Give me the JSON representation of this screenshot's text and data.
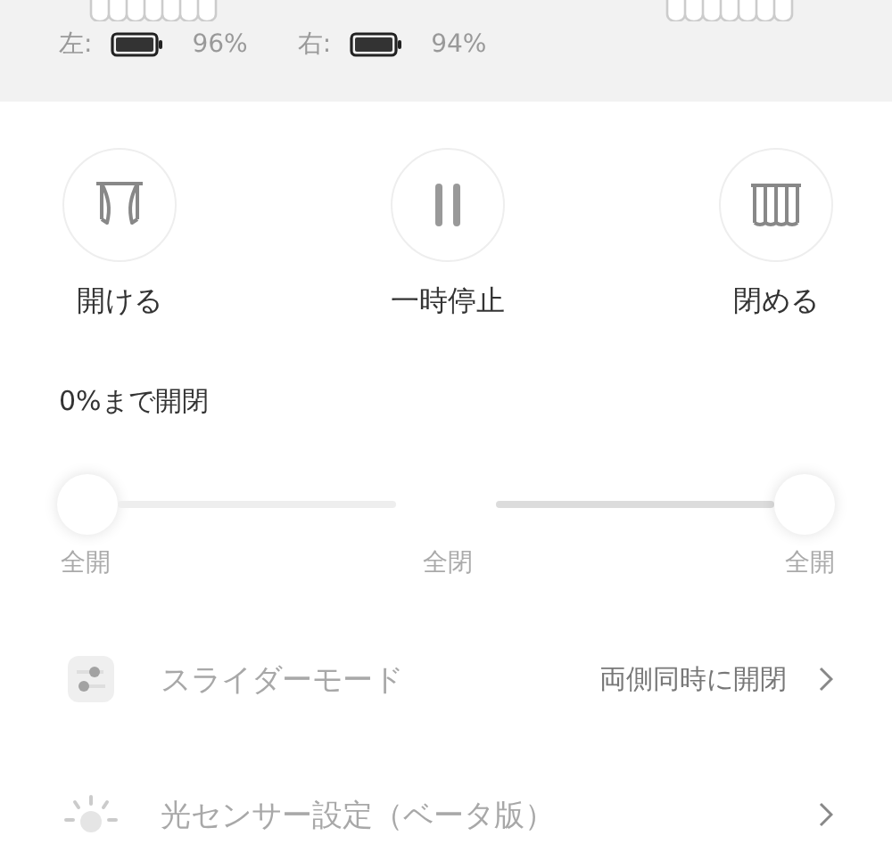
{
  "battery": [
    {
      "side": "左:",
      "percent": "96%"
    },
    {
      "side": "右:",
      "percent": "94%"
    }
  ],
  "controls": [
    {
      "kind": "open",
      "label": "開ける"
    },
    {
      "kind": "pause",
      "label": "一時停止"
    },
    {
      "kind": "close",
      "label": "閉める"
    }
  ],
  "position_title": "0%まで開閉",
  "slider_labels": [
    "全開",
    "全閉",
    "全開"
  ],
  "settings": [
    {
      "kind": "slider",
      "title": "スライダーモード",
      "value": "両側同時に開閉",
      "disabled": true
    },
    {
      "kind": "light",
      "title": "光センサー設定（ベータ版）",
      "disabled": true
    }
  ]
}
